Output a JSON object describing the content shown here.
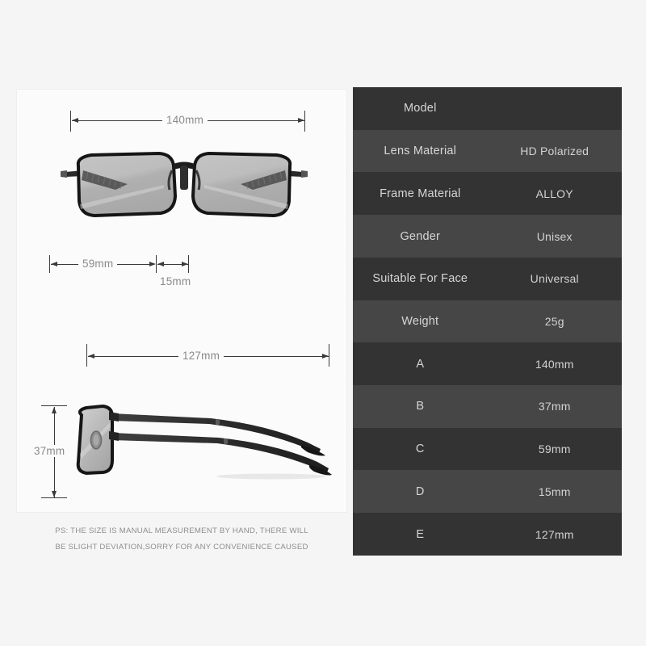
{
  "background_color": "#f5f5f5",
  "diagram": {
    "card_background": "#fbfbfb",
    "line_color": "#3a3a3a",
    "label_color": "#8a8a8a",
    "front_view": {
      "name": "eyeglasses-front-view",
      "total_width_label": "140mm",
      "lens_width_label": "59mm",
      "bridge_width_label": "15mm"
    },
    "side_view": {
      "name": "eyeglasses-side-view",
      "temple_length_label": "127mm",
      "lens_height_label": "37mm"
    },
    "footer_line1": "PS: THE SIZE IS MANUAL MEASUREMENT BY HAND, THERE WILL",
    "footer_line2": "BE SLIGHT DEVIATION,SORRY FOR ANY CONVENIENCE CAUSED"
  },
  "spec_table": {
    "row_color_odd": "#333333",
    "row_color_even": "#464646",
    "text_color": "#d6d6d6",
    "rows": [
      {
        "key": "Model",
        "value": ""
      },
      {
        "key": "Lens Material",
        "value": "HD Polarized"
      },
      {
        "key": "Frame Material",
        "value": "ALLOY"
      },
      {
        "key": "Gender",
        "value": "Unisex"
      },
      {
        "key": "Suitable For Face",
        "value": "Universal"
      },
      {
        "key": "Weight",
        "value": "25g"
      },
      {
        "key": "A",
        "value": "140mm"
      },
      {
        "key": "B",
        "value": "37mm"
      },
      {
        "key": "C",
        "value": "59mm"
      },
      {
        "key": "D",
        "value": "15mm"
      },
      {
        "key": "E",
        "value": "127mm"
      }
    ]
  }
}
